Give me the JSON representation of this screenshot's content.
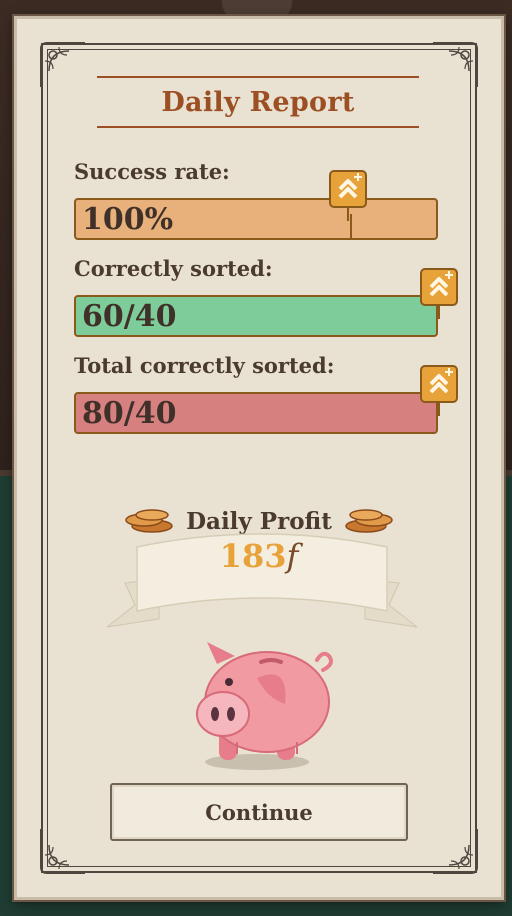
{
  "report": {
    "title": "Daily Report",
    "stats": [
      {
        "label": "Success rate:",
        "value": "100%",
        "color": "#e8b07a"
      },
      {
        "label": "Correctly sorted:",
        "value": "60/40",
        "color": "#7fcc9b"
      },
      {
        "label": "Total correctly sorted:",
        "value": "80/40",
        "color": "#d78080"
      }
    ],
    "profit_label": "Daily Profit",
    "profit_amount": "183",
    "currency_symbol": "f",
    "continue_label": "Continue"
  },
  "colors": {
    "title": "#9b4f23",
    "profit_value": "#e8a23a",
    "panel": "#e9e2d2"
  },
  "icons": [
    "upgrade-badge-icon",
    "coins-icon",
    "piggy-bank-icon",
    "ornament-corner-icon"
  ]
}
